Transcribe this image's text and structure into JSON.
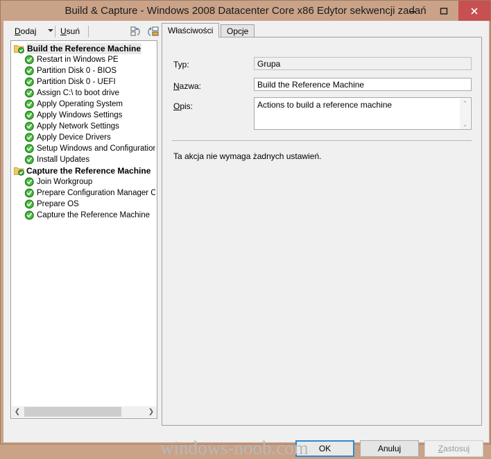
{
  "window": {
    "title": "Build & Capture - Windows 2008 Datacenter Core x86 Edytor sekwencji zadań",
    "minimize_label": "minimize",
    "maximize_label": "maximize",
    "close_label": "close",
    "frame_color": "#c9a288",
    "close_color": "#c75050"
  },
  "toolbar": {
    "add_label": "Dodaj",
    "add_accel": "D",
    "delete_label": "Usuń",
    "delete_accel": "U",
    "icon1_name": "collapse-all-icon",
    "icon2_name": "expand-all-icon"
  },
  "tree": {
    "items": [
      {
        "label": "Build the Reference Machine",
        "type": "group",
        "selected": true,
        "icon": "folder-check-icon"
      },
      {
        "label": "Restart in Windows PE",
        "type": "child",
        "selected": false,
        "icon": "green-check-icon"
      },
      {
        "label": "Partition Disk 0 - BIOS",
        "type": "child",
        "selected": false,
        "icon": "green-check-icon"
      },
      {
        "label": "Partition Disk 0 - UEFI",
        "type": "child",
        "selected": false,
        "icon": "green-check-icon"
      },
      {
        "label": "Assign C:\\ to boot drive",
        "type": "child",
        "selected": false,
        "icon": "green-check-icon"
      },
      {
        "label": "Apply Operating System",
        "type": "child",
        "selected": false,
        "icon": "green-check-icon"
      },
      {
        "label": "Apply Windows Settings",
        "type": "child",
        "selected": false,
        "icon": "green-check-icon"
      },
      {
        "label": "Apply Network Settings",
        "type": "child",
        "selected": false,
        "icon": "green-check-icon"
      },
      {
        "label": "Apply Device Drivers",
        "type": "child",
        "selected": false,
        "icon": "green-check-icon"
      },
      {
        "label": "Setup Windows and Configuration",
        "type": "child",
        "selected": false,
        "icon": "green-check-icon"
      },
      {
        "label": "Install Updates",
        "type": "child",
        "selected": false,
        "icon": "green-check-icon"
      },
      {
        "label": "Capture the Reference Machine",
        "type": "group",
        "selected": false,
        "icon": "folder-check-icon"
      },
      {
        "label": "Join Workgroup",
        "type": "child",
        "selected": false,
        "icon": "green-check-icon"
      },
      {
        "label": "Prepare Configuration Manager Cli",
        "type": "child",
        "selected": false,
        "icon": "green-check-icon"
      },
      {
        "label": "Prepare OS",
        "type": "child",
        "selected": false,
        "icon": "green-check-icon"
      },
      {
        "label": "Capture the Reference Machine",
        "type": "child",
        "selected": false,
        "icon": "green-check-icon"
      }
    ],
    "scroll_left_glyph": "❮",
    "scroll_right_glyph": "❯"
  },
  "tabs": [
    {
      "label": "Właściwości",
      "active": true
    },
    {
      "label": "Opcje",
      "active": false
    }
  ],
  "properties": {
    "type_label": "Typ:",
    "type_value": "Grupa",
    "name_label": "Nazwa:",
    "name_accel": "N",
    "name_value": "Build the Reference Machine",
    "description_label": "Opis:",
    "description_accel": "O",
    "description_value": "Actions to build a reference machine",
    "hint": "Ta akcja nie wymaga żadnych ustawień.",
    "scroll_up_glyph": "⌃",
    "scroll_down_glyph": "⌄"
  },
  "buttons": {
    "ok": "OK",
    "cancel": "Anuluj",
    "apply": "Zastosuj",
    "apply_accel": "Z",
    "focus_color": "#2a8ad4"
  },
  "watermark": "windows-noob.com"
}
